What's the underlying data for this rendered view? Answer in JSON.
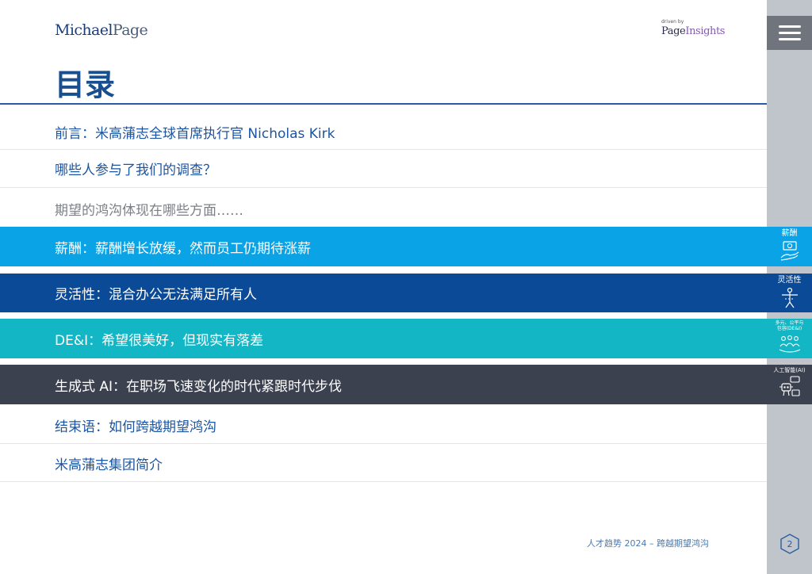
{
  "header": {
    "logo_michael": "Michael",
    "logo_page": "Page",
    "driven_by": "driven by",
    "insights_page": "Page",
    "insights_word": "Insights"
  },
  "title": "目录",
  "toc": [
    {
      "label": "前言：米高蒲志全球首席执行官 Nicholas Kirk"
    },
    {
      "label": "哪些人参与了我们的调查？"
    },
    {
      "label": "期望的鸿沟体现在哪些方面……"
    },
    {
      "label": "薪酬：薪酬增长放缓，然而员工仍期待涨薪",
      "color": "#0aa3e6"
    },
    {
      "label": "灵活性：混合办公无法满足所有人",
      "color": "#0b4a97"
    },
    {
      "label": "DE&I：希望很美好，但现实有落差",
      "color": "#12b6c4"
    },
    {
      "label": "生成式 AI：在职场飞速变化的时代紧跟时代步伐",
      "color": "#3c4150"
    },
    {
      "label": "结束语：如何跨越期望鸿沟"
    },
    {
      "label": "米高蒲志集团简介"
    }
  ],
  "footer": "人才趋势 2024 – 跨越期望鸿沟",
  "sidebar": {
    "tabs": [
      {
        "label": "薪酬",
        "icon": "money-hand-icon",
        "color": "#0aa3e6"
      },
      {
        "label": "灵活性",
        "icon": "person-flexibility-icon",
        "color": "#0b4a97"
      },
      {
        "label": "多元、公平与",
        "label2": "包容(DE&I)",
        "icon": "people-group-icon",
        "color": "#12b6c4"
      },
      {
        "label": "人工智能(AI)",
        "icon": "robot-icon",
        "color": "#3c4150"
      }
    ],
    "page_number": "2"
  }
}
